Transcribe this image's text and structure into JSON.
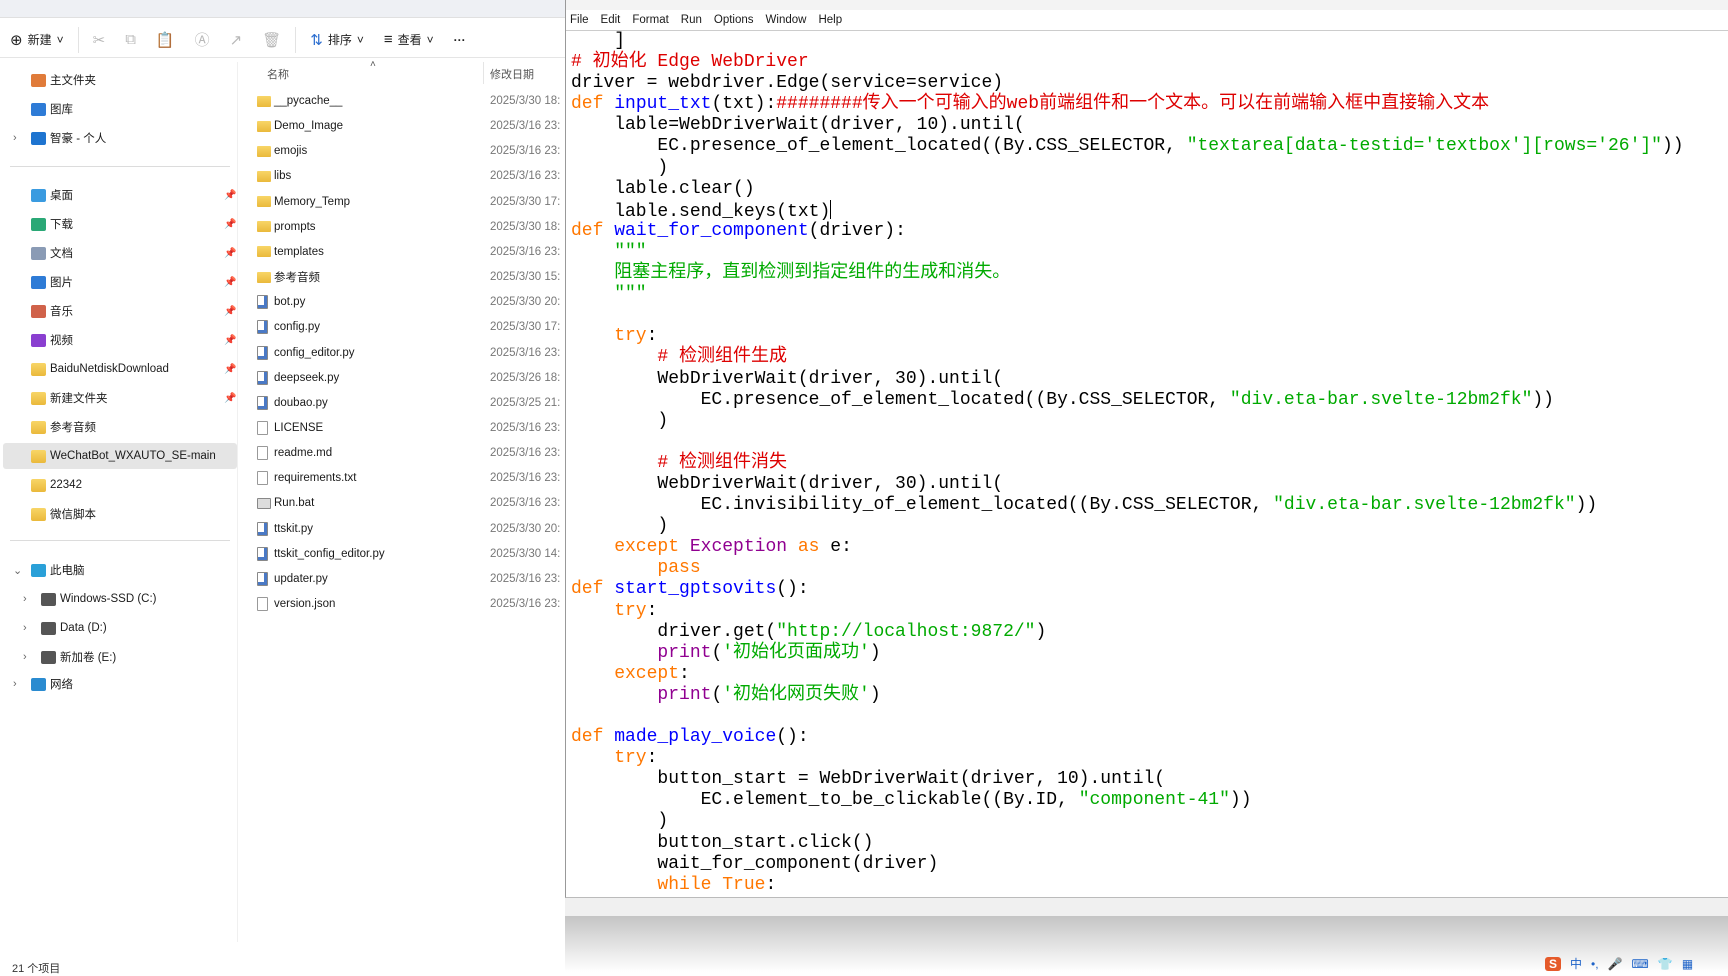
{
  "explorer": {
    "toolbar": {
      "new": "新建",
      "sort": "排序",
      "view": "查看",
      "more": "···"
    },
    "columns": {
      "name": "名称",
      "date": "修改日期"
    },
    "nav": [
      {
        "label": "主文件夹",
        "icon": "home-icon",
        "color": "#e07b3a"
      },
      {
        "label": "图库",
        "icon": "gallery-icon",
        "color": "#2e7bd6"
      },
      {
        "label": "智豪 - 个人",
        "icon": "onedrive-cloud-icon",
        "color": "#1e74d0",
        "chev": "›"
      },
      {
        "label": "桌面",
        "icon": "desktop-icon",
        "color": "#3a9be0",
        "pin": true
      },
      {
        "label": "下载",
        "icon": "download-icon",
        "color": "#2aa876",
        "pin": true
      },
      {
        "label": "文档",
        "icon": "documents-icon",
        "color": "#8a9bb5",
        "pin": true
      },
      {
        "label": "图片",
        "icon": "pictures-icon",
        "color": "#2e7bd6",
        "pin": true
      },
      {
        "label": "音乐",
        "icon": "music-icon",
        "color": "#d0624a",
        "pin": true
      },
      {
        "label": "视频",
        "icon": "videos-icon",
        "color": "#8a3fd0",
        "pin": true
      },
      {
        "label": "BaiduNetdiskDownload",
        "icon": "folder-icon",
        "pin": true
      },
      {
        "label": "新建文件夹",
        "icon": "folder-icon",
        "pin": true
      },
      {
        "label": "参考音频",
        "icon": "folder-icon"
      },
      {
        "label": "WeChatBot_WXAUTO_SE-main",
        "icon": "folder-icon",
        "selected": true
      },
      {
        "label": "22342",
        "icon": "folder-icon"
      },
      {
        "label": "微信脚本",
        "icon": "folder-icon"
      },
      {
        "label": "此电脑",
        "icon": "this-pc-icon",
        "color": "#2aa0d8",
        "chev": "⌄"
      },
      {
        "label": "Windows-SSD (C:)",
        "icon": "drive-icon",
        "color": "#555",
        "chev": "›",
        "sub": true
      },
      {
        "label": "Data (D:)",
        "icon": "drive-icon",
        "color": "#555",
        "chev": "›",
        "sub": true
      },
      {
        "label": "新加卷 (E:)",
        "icon": "drive-icon",
        "color": "#555",
        "chev": "›",
        "sub": true
      },
      {
        "label": "网络",
        "icon": "network-icon",
        "color": "#2a8bd0",
        "chev": "›"
      }
    ],
    "files": [
      {
        "name": "__pycache__",
        "date": "2025/3/30 18:",
        "type": "folder"
      },
      {
        "name": "Demo_Image",
        "date": "2025/3/16 23:",
        "type": "folder"
      },
      {
        "name": "emojis",
        "date": "2025/3/16 23:",
        "type": "folder"
      },
      {
        "name": "libs",
        "date": "2025/3/16 23:",
        "type": "folder"
      },
      {
        "name": "Memory_Temp",
        "date": "2025/3/30 17:",
        "type": "folder"
      },
      {
        "name": "prompts",
        "date": "2025/3/30 18:",
        "type": "folder"
      },
      {
        "name": "templates",
        "date": "2025/3/16 23:",
        "type": "folder"
      },
      {
        "name": "参考音频",
        "date": "2025/3/30 15:",
        "type": "folder"
      },
      {
        "name": "bot.py",
        "date": "2025/3/30 20:",
        "type": "py"
      },
      {
        "name": "config.py",
        "date": "2025/3/30 17:",
        "type": "py"
      },
      {
        "name": "config_editor.py",
        "date": "2025/3/16 23:",
        "type": "py"
      },
      {
        "name": "deepseek.py",
        "date": "2025/3/26 18:",
        "type": "py"
      },
      {
        "name": "doubao.py",
        "date": "2025/3/25 21:",
        "type": "py"
      },
      {
        "name": "LICENSE",
        "date": "2025/3/16 23:",
        "type": "file"
      },
      {
        "name": "readme.md",
        "date": "2025/3/16 23:",
        "type": "file"
      },
      {
        "name": "requirements.txt",
        "date": "2025/3/16 23:",
        "type": "file"
      },
      {
        "name": "Run.bat",
        "date": "2025/3/16 23:",
        "type": "bat"
      },
      {
        "name": "ttskit.py",
        "date": "2025/3/30 20:",
        "type": "py"
      },
      {
        "name": "ttskit_config_editor.py",
        "date": "2025/3/30 14:",
        "type": "py"
      },
      {
        "name": "updater.py",
        "date": "2025/3/16 23:",
        "type": "py"
      },
      {
        "name": "version.json",
        "date": "2025/3/16 23:",
        "type": "file"
      }
    ],
    "status": "21 个项目"
  },
  "idle": {
    "menu": [
      "File",
      "Edit",
      "Format",
      "Run",
      "Options",
      "Window",
      "Help"
    ],
    "code": [
      [
        [
          "n",
          "    ]"
        ]
      ],
      [
        [
          "cm",
          "# 初始化 Edge WebDriver"
        ]
      ],
      [
        [
          "n",
          "driver = webdriver.Edge(service=service)"
        ]
      ],
      [
        [
          "kw",
          "def"
        ],
        [
          "n",
          " "
        ],
        [
          "df",
          "input_txt"
        ],
        [
          "n",
          "(txt):"
        ],
        [
          "cm",
          "########传入一个可输入的web前端组件和一个文本。可以在前端输入框中直接输入文本"
        ]
      ],
      [
        [
          "n",
          "    lable=WebDriverWait(driver, 10).until("
        ]
      ],
      [
        [
          "n",
          "        EC.presence_of_element_located((By.CSS_SELECTOR, "
        ],
        [
          "st",
          "\"textarea[data-testid='textbox'][rows='26']\""
        ],
        [
          "n",
          "))"
        ]
      ],
      [
        [
          "n",
          "        )"
        ]
      ],
      [
        [
          "n",
          "    lable.clear()"
        ]
      ],
      [
        [
          "n",
          "    lable.send_keys(txt)"
        ]
      ],
      [
        [
          "kw",
          "def"
        ],
        [
          "n",
          " "
        ],
        [
          "df",
          "wait_for_component"
        ],
        [
          "n",
          "(driver):"
        ]
      ],
      [
        [
          "st",
          "    \"\"\""
        ]
      ],
      [
        [
          "st",
          "    阻塞主程序，直到检测到指定组件的生成和消失。"
        ]
      ],
      [
        [
          "st",
          "    \"\"\""
        ]
      ],
      [],
      [
        [
          "kw",
          "    try"
        ],
        [
          "n",
          ":"
        ]
      ],
      [
        [
          "cm",
          "        # 检测组件生成"
        ]
      ],
      [
        [
          "n",
          "        WebDriverWait(driver, 30).until("
        ]
      ],
      [
        [
          "n",
          "            EC.presence_of_element_located((By.CSS_SELECTOR, "
        ],
        [
          "st",
          "\"div.eta-bar.svelte-12bm2fk\""
        ],
        [
          "n",
          "))"
        ]
      ],
      [
        [
          "n",
          "        )"
        ]
      ],
      [],
      [
        [
          "cm",
          "        # 检测组件消失"
        ]
      ],
      [
        [
          "n",
          "        WebDriverWait(driver, 30).until("
        ]
      ],
      [
        [
          "n",
          "            EC.invisibility_of_element_located((By.CSS_SELECTOR, "
        ],
        [
          "st",
          "\"div.eta-bar.svelte-12bm2fk\""
        ],
        [
          "n",
          "))"
        ]
      ],
      [
        [
          "n",
          "        )"
        ]
      ],
      [
        [
          "kw",
          "    except"
        ],
        [
          "n",
          " "
        ],
        [
          "bi",
          "Exception"
        ],
        [
          "n",
          " "
        ],
        [
          "kw",
          "as"
        ],
        [
          "n",
          " e:"
        ]
      ],
      [
        [
          "kw",
          "        pass"
        ]
      ],
      [
        [
          "kw",
          "def"
        ],
        [
          "n",
          " "
        ],
        [
          "df",
          "start_gptsovits"
        ],
        [
          "n",
          "():"
        ]
      ],
      [
        [
          "kw",
          "    try"
        ],
        [
          "n",
          ":"
        ]
      ],
      [
        [
          "n",
          "        driver.get("
        ],
        [
          "st",
          "\"http://localhost:9872/\""
        ],
        [
          "n",
          ")"
        ]
      ],
      [
        [
          "bi",
          "        print"
        ],
        [
          "n",
          "("
        ],
        [
          "st",
          "'初始化页面成功'"
        ],
        [
          "n",
          ")"
        ]
      ],
      [
        [
          "kw",
          "    except"
        ],
        [
          "n",
          ":"
        ]
      ],
      [
        [
          "bi",
          "        print"
        ],
        [
          "n",
          "("
        ],
        [
          "st",
          "'初始化网页失败'"
        ],
        [
          "n",
          ")"
        ]
      ],
      [],
      [
        [
          "kw",
          "def"
        ],
        [
          "n",
          " "
        ],
        [
          "df",
          "made_play_voice"
        ],
        [
          "n",
          "():"
        ]
      ],
      [
        [
          "kw",
          "    try"
        ],
        [
          "n",
          ":"
        ]
      ],
      [
        [
          "n",
          "        button_start = WebDriverWait(driver, 10).until("
        ]
      ],
      [
        [
          "n",
          "            EC.element_to_be_clickable((By.ID, "
        ],
        [
          "st",
          "\"component-41\""
        ],
        [
          "n",
          "))"
        ]
      ],
      [
        [
          "n",
          "        )"
        ]
      ],
      [
        [
          "n",
          "        button_start.click()"
        ]
      ],
      [
        [
          "n",
          "        wait_for_component(driver)"
        ]
      ],
      [
        [
          "kw",
          "        while"
        ],
        [
          "n",
          " "
        ],
        [
          "kw",
          "True"
        ],
        [
          "n",
          ":"
        ]
      ]
    ],
    "cursor_line": 8
  },
  "ime": {
    "logo": "S",
    "mode": "中"
  }
}
